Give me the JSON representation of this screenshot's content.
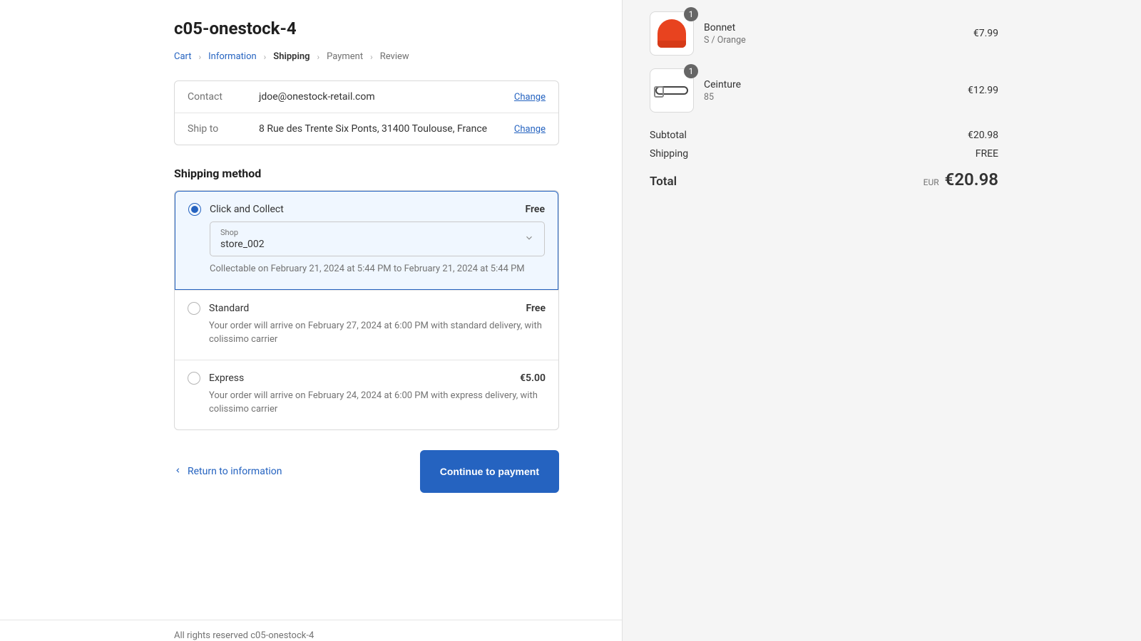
{
  "header": {
    "title": "c05-onestock-4"
  },
  "breadcrumb": {
    "cart": "Cart",
    "information": "Information",
    "shipping": "Shipping",
    "payment": "Payment",
    "review": "Review"
  },
  "info": {
    "contact_label": "Contact",
    "contact_value": "jdoe@onestock-retail.com",
    "shipto_label": "Ship to",
    "shipto_value": "8 Rue des Trente Six Ponts, 31400 Toulouse, France",
    "change": "Change"
  },
  "shipping": {
    "heading": "Shipping method",
    "options": {
      "click_collect": {
        "title": "Click and Collect",
        "price": "Free",
        "shop_label": "Shop",
        "shop_value": "store_002",
        "desc": "Collectable on February 21, 2024 at 5:44 PM to February 21, 2024 at 5:44 PM"
      },
      "standard": {
        "title": "Standard",
        "price": "Free",
        "desc": "Your order will arrive on February 27, 2024 at 6:00 PM with standard delivery, with colissimo carrier"
      },
      "express": {
        "title": "Express",
        "price": "€5.00",
        "desc": "Your order will arrive on February 24, 2024 at 6:00 PM with express delivery, with colissimo carrier"
      }
    }
  },
  "actions": {
    "return": "Return to information",
    "continue": "Continue to payment"
  },
  "footer": {
    "text": "All rights reserved c05-onestock-4"
  },
  "cart": {
    "items": [
      {
        "qty": "1",
        "name": "Bonnet",
        "variant": "S / Orange",
        "price": "€7.99"
      },
      {
        "qty": "1",
        "name": "Ceinture",
        "variant": "85",
        "price": "€12.99"
      }
    ],
    "subtotal_label": "Subtotal",
    "subtotal_value": "€20.98",
    "shipping_label": "Shipping",
    "shipping_value": "FREE",
    "total_label": "Total",
    "total_currency": "EUR",
    "total_amount": "€20.98"
  }
}
